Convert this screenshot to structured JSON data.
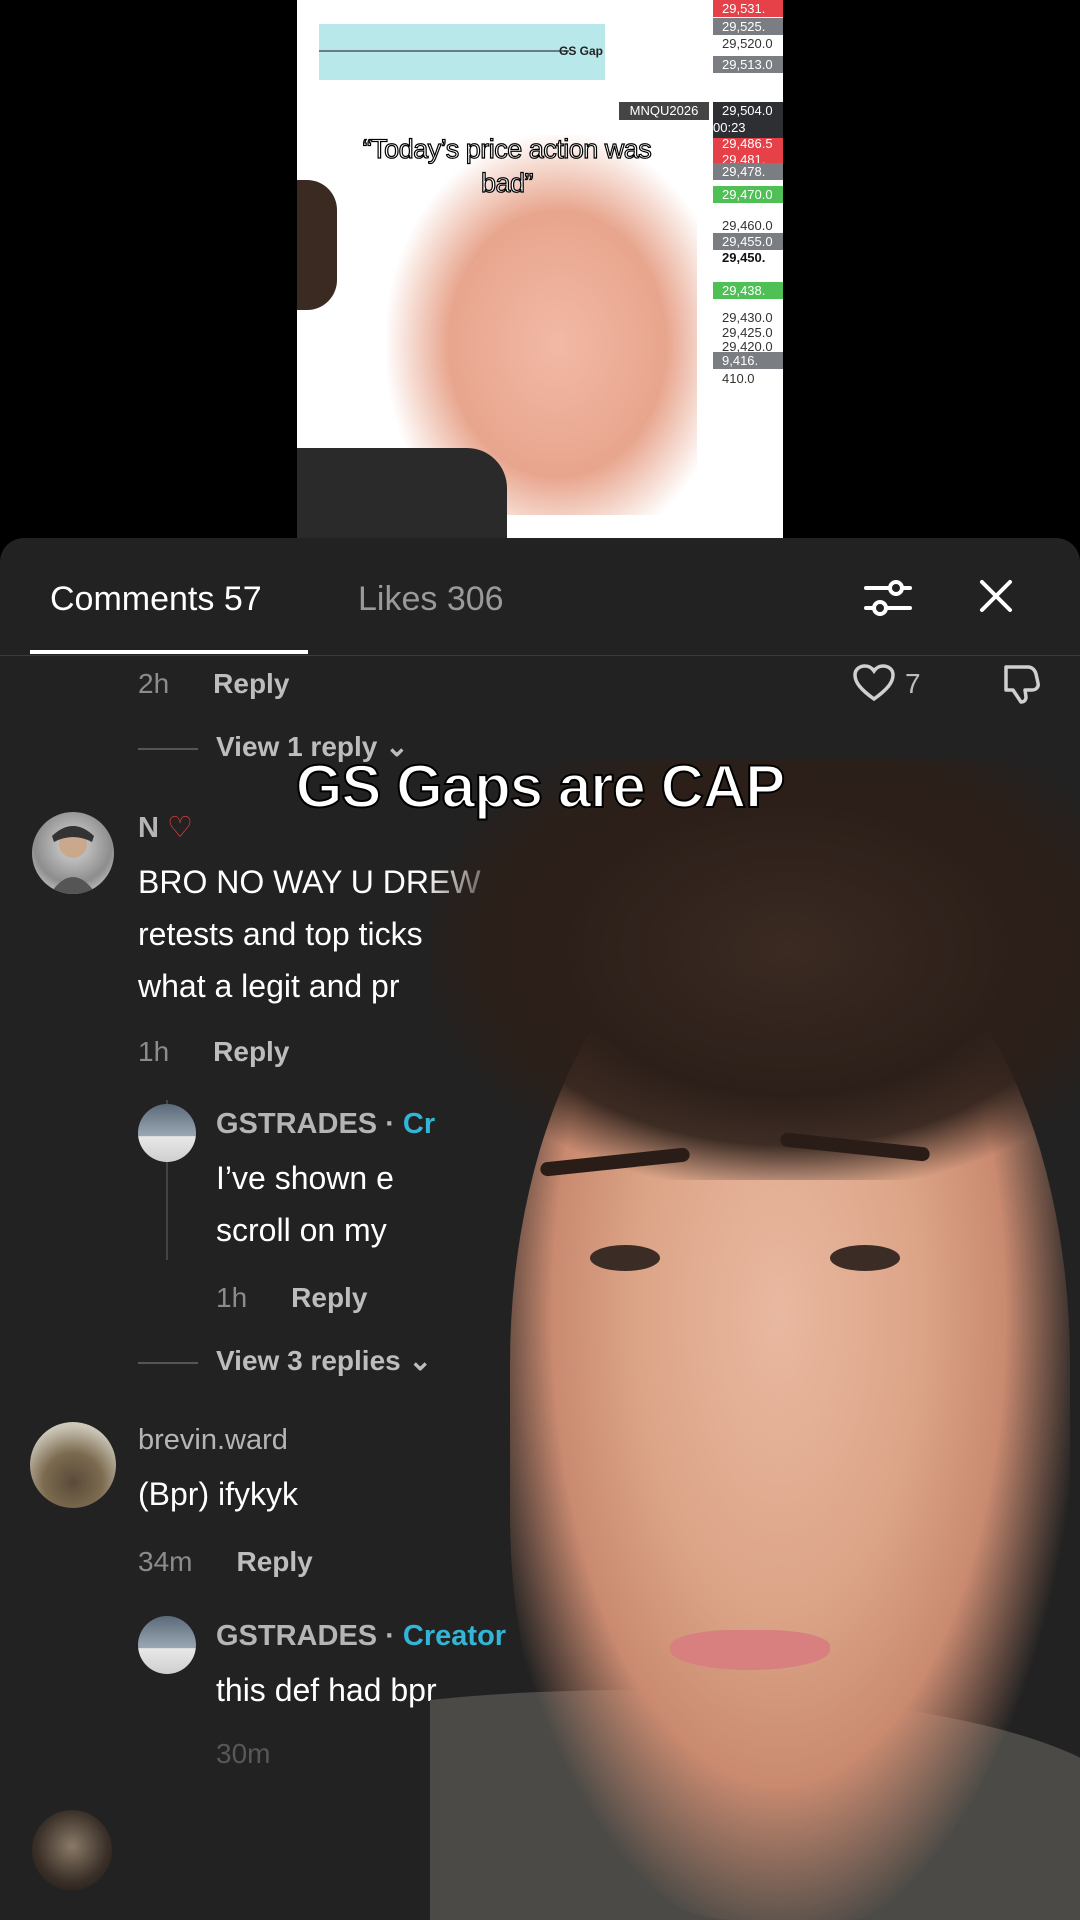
{
  "top_video": {
    "caption": "“Today’s price action was bad”",
    "gap_label": "GS Gap",
    "ticker": "MNQU2026",
    "countdown": "00:23",
    "price_ladder": [
      {
        "text": "29,531.",
        "style": "red"
      },
      {
        "text": "29,525.",
        "style": "gray"
      },
      {
        "text": "29,520.0",
        "style": "plain"
      },
      {
        "text": "29,513.0",
        "style": "gray"
      },
      {
        "text": "29,504.0",
        "style": "plain"
      },
      {
        "text": "29,486.5",
        "style": "red"
      },
      {
        "text": "29,481.",
        "style": "red"
      },
      {
        "text": "29,478.",
        "style": "gray"
      },
      {
        "text": "29,470.0",
        "style": "green"
      },
      {
        "text": "29,460.0",
        "style": "plain"
      },
      {
        "text": "29,455.0",
        "style": "gray"
      },
      {
        "text": "29,450.",
        "style": "bold"
      },
      {
        "text": "29,438.",
        "style": "green"
      },
      {
        "text": "29,430.0",
        "style": "plain"
      },
      {
        "text": "29,425.0",
        "style": "plain"
      },
      {
        "text": "29,420.0",
        "style": "plain"
      },
      {
        "text": "9,416.",
        "style": "gray"
      },
      {
        "text": "410.0",
        "style": "plain"
      }
    ]
  },
  "sheet": {
    "tabs": [
      {
        "label": "Comments 57",
        "active": true
      },
      {
        "label": "Likes 306",
        "active": false
      }
    ],
    "first_row": {
      "time": "2h",
      "reply": "Reply",
      "likes": "7"
    },
    "view_reply_1": "View 1 reply",
    "comments": [
      {
        "username": "N",
        "text_lines": [
          "BRO NO WAY U DREW",
          "retests and top ticks",
          "what a legit and pr"
        ],
        "time": "1h",
        "reply": "Reply"
      },
      {
        "username": "GSTRADES",
        "creator": "Cr",
        "text_lines": [
          "I’ve shown e",
          "scroll on my"
        ],
        "time": "1h",
        "reply": "Reply"
      },
      {
        "username": "brevin.ward",
        "text_lines": [
          "(Bpr) ifykyk"
        ],
        "time": "34m",
        "reply": "Reply"
      },
      {
        "username": "GSTRADES",
        "creator": "Creator",
        "text_lines": [
          "this def had bpr"
        ],
        "time": "30m",
        "reply": ""
      }
    ],
    "view_replies_3": "View 3 replies"
  },
  "overlay_caption": "GS Gaps are CAP",
  "colors": {
    "sheet_bg": "#222222",
    "creator": "#32b5d6",
    "text_muted": "#8c8c8c"
  }
}
